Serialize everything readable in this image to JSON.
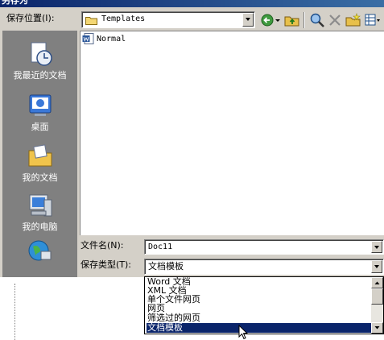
{
  "window": {
    "title": "另存为"
  },
  "toolbar": {
    "save_in_label": "保存位置(I):",
    "location_value": "Templates",
    "back_icon": "back-arrow-icon",
    "up_icon": "up-folder-icon",
    "search_icon": "search-web-icon",
    "delete_icon": "delete-x-icon",
    "new_folder_icon": "new-folder-icon",
    "views_icon": "views-grid-icon"
  },
  "sidebar": {
    "items": [
      {
        "label": "我最近的文档",
        "icon": "recent-documents-icon"
      },
      {
        "label": "桌面",
        "icon": "desktop-icon"
      },
      {
        "label": "我的文档",
        "icon": "my-documents-icon"
      },
      {
        "label": "我的电脑",
        "icon": "my-computer-icon"
      },
      {
        "label": "",
        "icon": "network-places-icon"
      }
    ]
  },
  "files": [
    {
      "name": "Normal",
      "icon": "word-document-icon"
    }
  ],
  "form": {
    "filename_label": "文件名(N):",
    "filename_value": "Doc11",
    "filetype_label": "保存类型(T):",
    "filetype_value": "文档模板"
  },
  "filetype_options": [
    {
      "label": "Word 文档",
      "selected": false
    },
    {
      "label": "XML 文档",
      "selected": false
    },
    {
      "label": "单个文件网页",
      "selected": false
    },
    {
      "label": "网页",
      "selected": false
    },
    {
      "label": "筛选过的网页",
      "selected": false
    },
    {
      "label": "文档模板",
      "selected": true
    }
  ],
  "colors": {
    "dialog_bg": "#d4d0c8",
    "selection": "#0a246a",
    "sidebar_bg": "#808080"
  }
}
